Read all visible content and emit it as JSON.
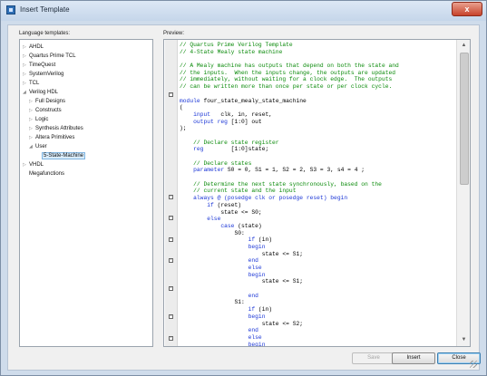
{
  "window": {
    "title": "Insert Template",
    "close_glyph": "x"
  },
  "labels": {
    "language_templates": "Language templates:",
    "preview": "Preview:"
  },
  "tree": [
    {
      "label": "AHDL",
      "arrow": "▷",
      "indent": 0
    },
    {
      "label": "Quartus Prime TCL",
      "arrow": "▷",
      "indent": 0
    },
    {
      "label": "TimeQuest",
      "arrow": "▷",
      "indent": 0
    },
    {
      "label": "SystemVerilog",
      "arrow": "▷",
      "indent": 0
    },
    {
      "label": "TCL",
      "arrow": "▷",
      "indent": 0
    },
    {
      "label": "Verilog HDL",
      "arrow": "◢",
      "indent": 0
    },
    {
      "label": "Full Designs",
      "arrow": "▷",
      "indent": 1
    },
    {
      "label": "Constructs",
      "arrow": "▷",
      "indent": 1
    },
    {
      "label": "Logic",
      "arrow": "▷",
      "indent": 1
    },
    {
      "label": "Synthesis Attributes",
      "arrow": "▷",
      "indent": 1
    },
    {
      "label": "Altera Primitives",
      "arrow": "▷",
      "indent": 1
    },
    {
      "label": "User",
      "arrow": "◢",
      "indent": 1
    },
    {
      "label": "5-State-Machine",
      "arrow": "",
      "indent": 2,
      "selected": true
    },
    {
      "label": "VHDL",
      "arrow": "▷",
      "indent": 0
    },
    {
      "label": "Megafunctions",
      "arrow": "",
      "indent": 0
    }
  ],
  "code_lines": [
    {
      "type": "comment",
      "text": "// Quartus Prime Verilog Template"
    },
    {
      "type": "comment",
      "text": "// 4-State Mealy state machine"
    },
    {
      "type": "plain",
      "text": ""
    },
    {
      "type": "comment",
      "text": "// A Mealy machine has outputs that depend on both the state and"
    },
    {
      "type": "comment",
      "text": "// the inputs.  When the inputs change, the outputs are updated"
    },
    {
      "type": "comment",
      "text": "// immediately, without waiting for a clock edge.  The outputs"
    },
    {
      "type": "comment",
      "text": "// can be written more than once per state or per clock cycle."
    },
    {
      "type": "plain",
      "text": ""
    },
    {
      "type": "kwplain",
      "kw": "module",
      "text": " four_state_mealy_state_machine"
    },
    {
      "type": "plain",
      "text": "("
    },
    {
      "type": "kwplain",
      "kw": "    input",
      "text": "   clk, in, reset,"
    },
    {
      "type": "kwplain",
      "kw": "    output reg",
      "text": " [1:0] out"
    },
    {
      "type": "plain",
      "text": ");"
    },
    {
      "type": "plain",
      "text": ""
    },
    {
      "type": "comment",
      "text": "    // Declare state register"
    },
    {
      "type": "kwplain",
      "kw": "    reg",
      "text": "        [1:0]state;"
    },
    {
      "type": "plain",
      "text": ""
    },
    {
      "type": "comment",
      "text": "    // Declare states"
    },
    {
      "type": "kwplain",
      "kw": "    parameter",
      "text": " S0 = 0, S1 = 1, S2 = 2, S3 = 3, s4 = 4 ;"
    },
    {
      "type": "plain",
      "text": ""
    },
    {
      "type": "comment",
      "text": "    // Determine the next state synchronously, based on the"
    },
    {
      "type": "comment",
      "text": "    // current state and the input"
    },
    {
      "type": "kw",
      "text": "    always @ (posedge clk or posedge reset) begin"
    },
    {
      "type": "kwplain",
      "kw": "        if",
      "text": " (reset)"
    },
    {
      "type": "plain",
      "text": "            state <= S0;"
    },
    {
      "type": "kw",
      "text": "        else"
    },
    {
      "type": "kwplain",
      "kw": "            case",
      "text": " (state)"
    },
    {
      "type": "plain",
      "text": "                S0:"
    },
    {
      "type": "kwplain",
      "kw": "                    if",
      "text": " (in)"
    },
    {
      "type": "kw",
      "text": "                    begin"
    },
    {
      "type": "plain",
      "text": "                        state <= S1;"
    },
    {
      "type": "kw",
      "text": "                    end"
    },
    {
      "type": "kw",
      "text": "                    else"
    },
    {
      "type": "kw",
      "text": "                    begin"
    },
    {
      "type": "plain",
      "text": "                        state <= S1;"
    },
    {
      "type": "plain",
      "text": ""
    },
    {
      "type": "kw",
      "text": "                    end"
    },
    {
      "type": "plain",
      "text": "                S1:"
    },
    {
      "type": "kwplain",
      "kw": "                    if",
      "text": " (in)"
    },
    {
      "type": "kw",
      "text": "                    begin"
    },
    {
      "type": "plain",
      "text": "                        state <= S2;"
    },
    {
      "type": "kw",
      "text": "                    end"
    },
    {
      "type": "kw",
      "text": "                    else"
    },
    {
      "type": "kw",
      "text": "                    begin"
    },
    {
      "type": "plain",
      "text": "                        state <= S1;"
    },
    {
      "type": "kw",
      "text": "                    end"
    }
  ],
  "buttons": {
    "save": "Save",
    "insert": "Insert",
    "close": "Close"
  },
  "colors": {
    "comment": "#0a8a0a",
    "keyword": "#1a35d6"
  }
}
